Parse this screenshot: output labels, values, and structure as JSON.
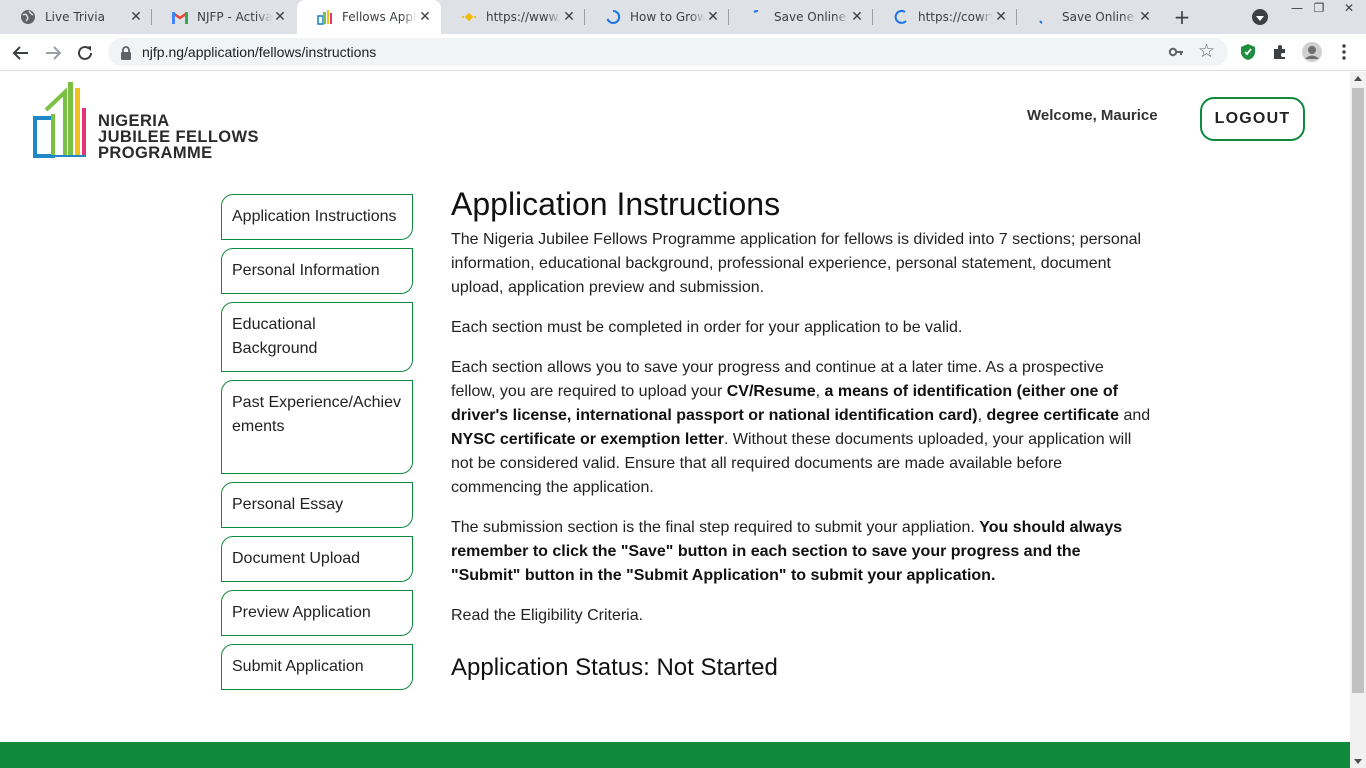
{
  "browser": {
    "tabs": [
      {
        "title": "Live Trivia",
        "icon": "globe-icon"
      },
      {
        "title": "NJFP - Activation",
        "icon": "gmail-icon"
      },
      {
        "title": "Fellows Application",
        "icon": "njfp-icon",
        "active": true
      },
      {
        "title": "https://www.binance",
        "icon": "binance-icon"
      },
      {
        "title": "How to Grow Money",
        "icon": "loading-icon"
      },
      {
        "title": "Save Online in Nigeria",
        "icon": "loading-icon"
      },
      {
        "title": "https://cowrywise",
        "icon": "loading-icon"
      },
      {
        "title": "Save Online in Nigeria",
        "icon": "loading-icon"
      }
    ],
    "new_tab_label": "+",
    "url": "njfp.ng/application/fellows/instructions"
  },
  "header": {
    "logo_line1": "NIGERIA",
    "logo_line2": "JUBILEE FELLOWS",
    "logo_line3": "PROGRAMME",
    "welcome": "Welcome, Maurice",
    "logout_label": "LOGOUT"
  },
  "sidebar": {
    "items": [
      {
        "label": "Application Instructions"
      },
      {
        "label": "Personal Information"
      },
      {
        "label": "Educational Background"
      },
      {
        "label": "Past Experience/Achievements"
      },
      {
        "label": "Personal Essay"
      },
      {
        "label": "Document Upload"
      },
      {
        "label": "Preview Application"
      },
      {
        "label": "Submit Application"
      }
    ]
  },
  "main": {
    "title": "Application Instructions",
    "p1": "The Nigeria Jubilee Fellows Programme application for fellows is divided into 7 sections; personal information, educational background, professional experience, personal statement, document upload, application preview and submission.",
    "p2": "Each section must be completed in order for your application to be valid.",
    "p3": {
      "t1": "Each section allows you to save your progress and continue at a later time. As a prospective fellow, you are required to upload your ",
      "b1": "CV/Resume",
      "t2": ", ",
      "b2": "a means of identification (either one of driver's license, international passport or national identification card)",
      "t3": ", ",
      "b3": "degree certificate",
      "t4": " and ",
      "b4": "NYSC certificate or exemption letter",
      "t5": ". Without these documents uploaded, your application will not be considered valid. Ensure that all required documents are made available before commencing the application."
    },
    "p4": {
      "t1": "The submission section is the final step required to submit your appliation. ",
      "b1": "You should always remember to click the \"Save\" button in each section to save your progress and the \"Submit\" button in the \"Submit Application\" to submit your application."
    },
    "p5": "Read the Eligibility Criteria.",
    "status": "Application Status: Not Started"
  },
  "colors": {
    "brand_green": "#0f8a3c",
    "logo_blue": "#1e88c8",
    "logo_yellow": "#f2c21b",
    "logo_pink": "#e0337a"
  }
}
